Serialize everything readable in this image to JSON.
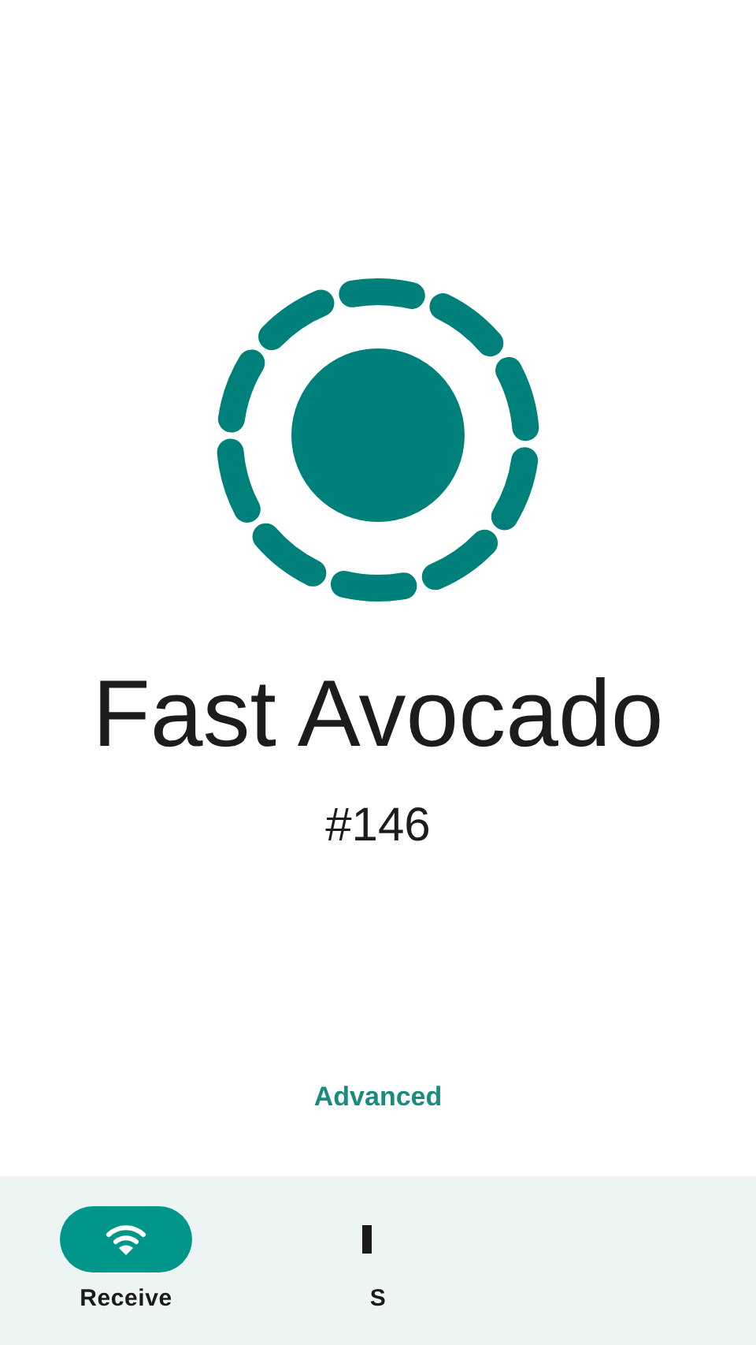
{
  "device": {
    "name": "Fast Avocado",
    "number": "#146"
  },
  "advanced_link": "Advanced",
  "nav": [
    {
      "label": "Receive",
      "selected": true
    },
    {
      "label": "S",
      "selected": false
    }
  ]
}
